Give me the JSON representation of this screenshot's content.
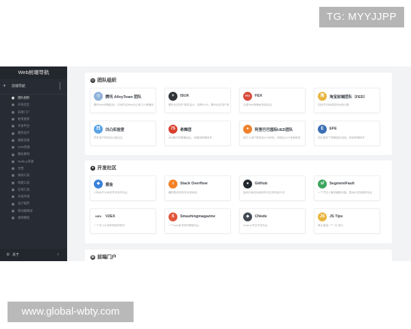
{
  "watermark": {
    "top": "TG: MYYJJPP",
    "bottom": "www.global-wbty.com"
  },
  "sidebar": {
    "title": "Web前端导航",
    "group": {
      "icon": "✈",
      "label": "前端导航"
    },
    "items": [
      {
        "label": "团队组织",
        "active": true
      },
      {
        "label": "开发社区",
        "active": false
      },
      {
        "label": "前端门户",
        "active": false
      },
      {
        "label": "框架类库",
        "active": false
      },
      {
        "label": "开发平台",
        "active": false
      },
      {
        "label": "图形设计",
        "active": false
      },
      {
        "label": "模板资源",
        "active": false
      },
      {
        "label": "CSS资源",
        "active": false
      },
      {
        "label": "图标素材",
        "active": false
      },
      {
        "label": "Node.js资源",
        "active": false
      },
      {
        "label": "文档",
        "active": false
      },
      {
        "label": "调试工具",
        "active": false
      },
      {
        "label": "构建工具",
        "active": false
      },
      {
        "label": "在线工具",
        "active": false
      },
      {
        "label": "开发环境",
        "active": false
      },
      {
        "label": "设计规范",
        "active": false
      },
      {
        "label": "移动端调试",
        "active": false
      },
      {
        "label": "视频教程",
        "active": false
      }
    ],
    "footer": {
      "icon": "⚙",
      "label": "关于",
      "arrow": "›"
    }
  },
  "sections": [
    {
      "title": "团队组织",
      "icon": "◎",
      "sites": [
        {
          "name": "腾讯 AlloyTeam 团队",
          "desc": "腾讯Web前端团队，代表作品WebQQ,致力于前端技术的研究",
          "logo": "◎",
          "color": "#8fb3d9"
        },
        {
          "name": "ISUX",
          "desc": "腾讯社交用户体验设计，简称ISUX，腾讯社交用户体验设计团队",
          "logo": "✕",
          "color": "#2f3338"
        },
        {
          "name": "FEX",
          "desc": "百度Web前端研发部出品",
          "logo": "FEX",
          "color": "#d94b3c"
        },
        {
          "name": "淘宝前端团队（FED）",
          "desc": "用技术为体验提供无限可能",
          "logo": "淘",
          "color": "#e8b43c"
        },
        {
          "name": "凹凸实验室",
          "desc": "京东用户体验设计部出品",
          "logo": "凹",
          "color": "#5aa3e6"
        },
        {
          "name": "奇舞团",
          "desc": "360最大的前端团队，奇舞团前端技术",
          "logo": "75",
          "color": "#d9402e"
        },
        {
          "name": "阿里巴巴国际UED团队",
          "desc": "致力于用户体验设计与研发，帮助设计开发者体验",
          "logo": "●",
          "color": "#f0822d"
        },
        {
          "name": "EFE",
          "desc": "由百度多个前端团队组成，探索前端技术",
          "logo": "E",
          "color": "#3a6fb5"
        }
      ]
    },
    {
      "title": "开发社区",
      "icon": "●",
      "sites": [
        {
          "name": "掘金",
          "desc": "只有高手分享的中文技术社区",
          "logo": "◆",
          "color": "#3b82d9"
        },
        {
          "name": "Stack Overflow",
          "desc": "编程相关的技术问答网站",
          "logo": "≡",
          "color": "#f48024"
        },
        {
          "name": "GitHub",
          "desc": "面向开源及私有软件项目的托管平台",
          "logo": "●",
          "color": "#24292e"
        },
        {
          "name": "SegmentFault",
          "desc": "一个专注于解决编程问题，提高开发技能的社区",
          "logo": "sf",
          "color": "#3ba55c"
        },
        {
          "name": "V2EX",
          "desc": "一个关于分享和探索的地方",
          "logo": "V2EX",
          "color": "#ffffff"
        },
        {
          "name": "Smashingmagazine",
          "desc": "一个web技术类的博客社区",
          "logo": "S",
          "color": "#e0553b"
        },
        {
          "name": "CNode",
          "desc": "Node.js专业中文社区",
          "logo": "◆",
          "color": "#444b55"
        },
        {
          "name": "JS Tips",
          "desc": "每天推送一个 JS 技巧",
          "logo": "JS",
          "color": "#e8b43c"
        }
      ]
    },
    {
      "title": "前端门户",
      "icon": "▦",
      "sites": []
    }
  ]
}
